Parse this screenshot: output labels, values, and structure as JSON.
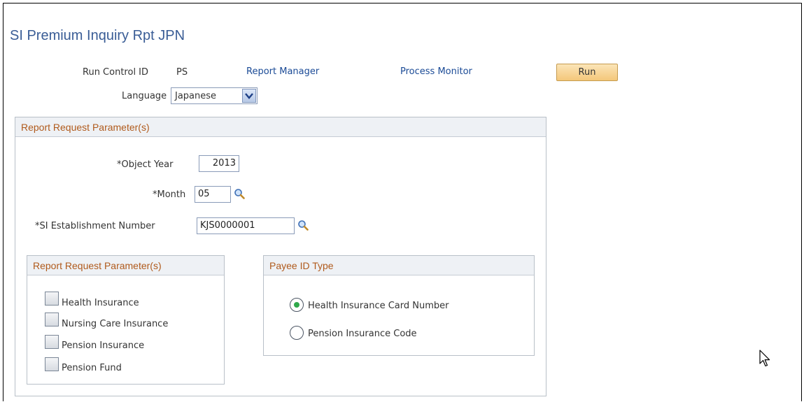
{
  "page": {
    "title": "SI Premium Inquiry Rpt JPN"
  },
  "header": {
    "run_control_label": "Run Control ID",
    "run_control_value": "PS",
    "report_manager_link": "Report Manager",
    "process_monitor_link": "Process Monitor",
    "run_button": "Run",
    "language_label": "Language",
    "language_value": "Japanese"
  },
  "params": {
    "title": "Report Request Parameter(s)",
    "object_year_label": "*Object Year",
    "object_year_value": "2013",
    "month_label": "*Month",
    "month_value": "05",
    "establishment_label": "*SI Establishment Number",
    "establishment_value": "KJS0000001"
  },
  "insurance": {
    "title": "Report Request Parameter(s)",
    "items": [
      {
        "label": "Health Insurance",
        "checked": false
      },
      {
        "label": "Nursing Care Insurance",
        "checked": false
      },
      {
        "label": "Pension Insurance",
        "checked": false
      },
      {
        "label": "Pension Fund",
        "checked": false
      }
    ]
  },
  "payee": {
    "title": "Payee ID Type",
    "options": [
      {
        "label": "Health Insurance Card Number",
        "selected": true
      },
      {
        "label": "Pension Insurance Code",
        "selected": false
      }
    ]
  },
  "icons": {
    "lookup": "magnifier-icon",
    "dropdown": "chevron-down-icon",
    "cursor": "mouse-pointer-icon"
  },
  "colors": {
    "title": "#3a5d96",
    "group_header_text": "#b05a1c",
    "link": "#1a4a96",
    "run_button": "#f4c77a",
    "radio_selected": "#2fa84a"
  }
}
